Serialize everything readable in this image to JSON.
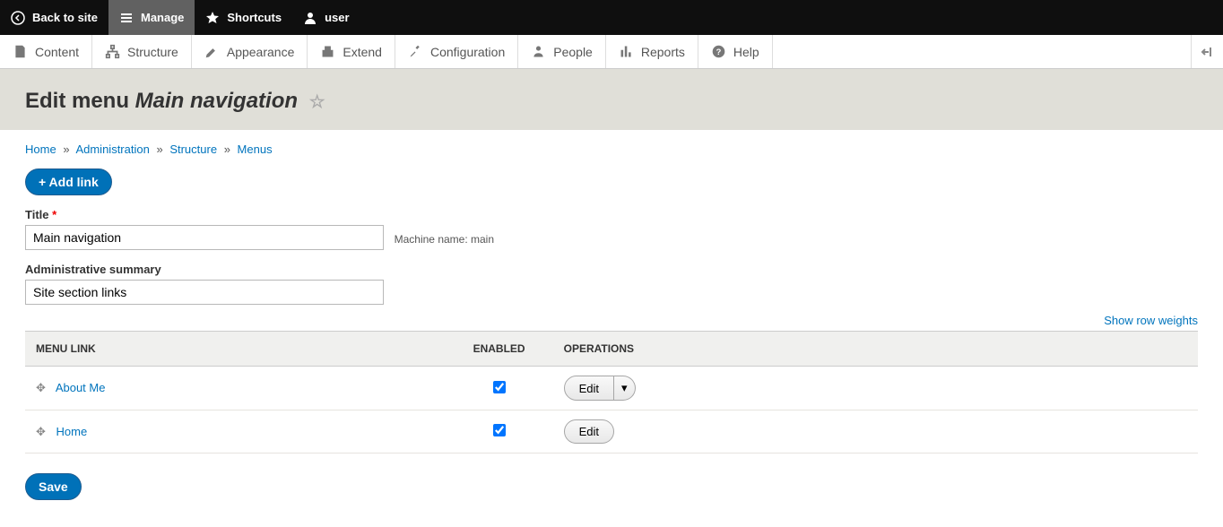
{
  "toolbar": {
    "back": "Back to site",
    "manage": "Manage",
    "shortcuts": "Shortcuts",
    "user": "user"
  },
  "admin_menu": {
    "content": "Content",
    "structure": "Structure",
    "appearance": "Appearance",
    "extend": "Extend",
    "configuration": "Configuration",
    "people": "People",
    "reports": "Reports",
    "help": "Help"
  },
  "page_title_prefix": "Edit menu ",
  "page_title_name": "Main navigation",
  "breadcrumb": {
    "home": "Home",
    "administration": "Administration",
    "structure": "Structure",
    "menus": "Menus"
  },
  "add_link": "+ Add link",
  "form": {
    "title_label": "Title",
    "title_value": "Main navigation",
    "machine_name_label": "Machine name: ",
    "machine_name_value": "main",
    "summary_label": "Administrative summary",
    "summary_value": "Site section links"
  },
  "show_weights": "Show row weights",
  "table": {
    "headers": {
      "menu_link": "MENU LINK",
      "enabled": "ENABLED",
      "operations": "OPERATIONS"
    },
    "rows": [
      {
        "label": "About Me",
        "enabled": true,
        "has_dropdown": true,
        "edit": "Edit"
      },
      {
        "label": "Home",
        "enabled": true,
        "has_dropdown": false,
        "edit": "Edit"
      }
    ]
  },
  "save": "Save"
}
